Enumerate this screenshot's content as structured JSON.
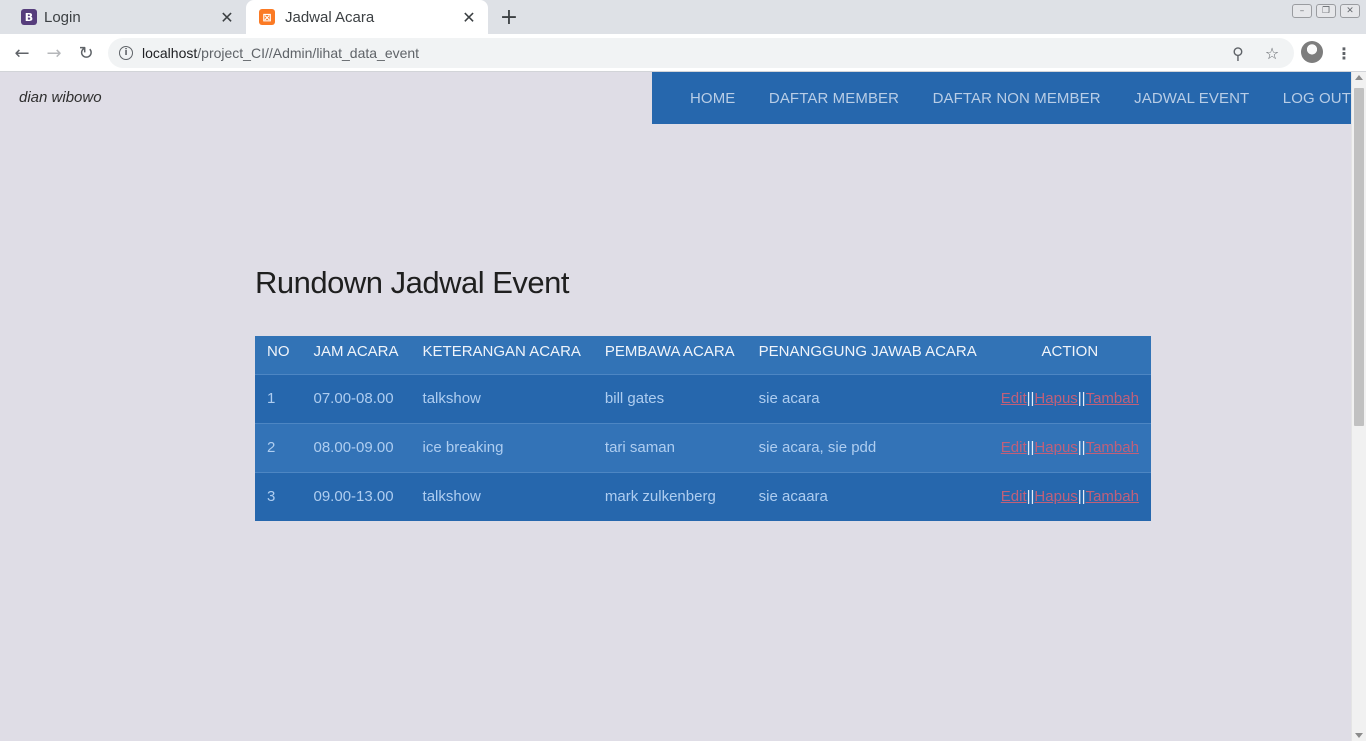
{
  "browser": {
    "tabs": [
      {
        "label": "Login",
        "favicon": "B"
      },
      {
        "label": "Jadwal Acara",
        "favicon": "xampp-icon"
      }
    ],
    "url_host": "localhost",
    "url_path": "/project_CI//Admin/lihat_data_event"
  },
  "header": {
    "brand": "dian wibowo",
    "nav": [
      "HOME",
      "DAFTAR MEMBER",
      "DAFTAR NON MEMBER",
      "JADWAL EVENT",
      "LOG OUT"
    ]
  },
  "main": {
    "title": "Rundown Jadwal Event",
    "table": {
      "columns": [
        "NO",
        "JAM ACARA",
        "KETERANGAN ACARA",
        "PEMBAWA ACARA",
        "PENANGGUNG JAWAB ACARA",
        "ACTION"
      ],
      "rows": [
        [
          "1",
          "07.00-08.00",
          "talkshow",
          "bill gates",
          "sie acara"
        ],
        [
          "2",
          "08.00-09.00",
          "ice breaking",
          "tari saman",
          "sie acara, sie pdd"
        ],
        [
          "3",
          "09.00-13.00",
          "talkshow",
          "mark zulkenberg",
          "sie acaara"
        ]
      ],
      "actions": {
        "edit": "Edit",
        "hapus": "Hapus",
        "tambah": "Tambah",
        "separator": "||"
      }
    }
  },
  "colors": {
    "nav_bg": "#2667ad",
    "page_bg": "#dfdde6",
    "link": "#c0607a"
  }
}
